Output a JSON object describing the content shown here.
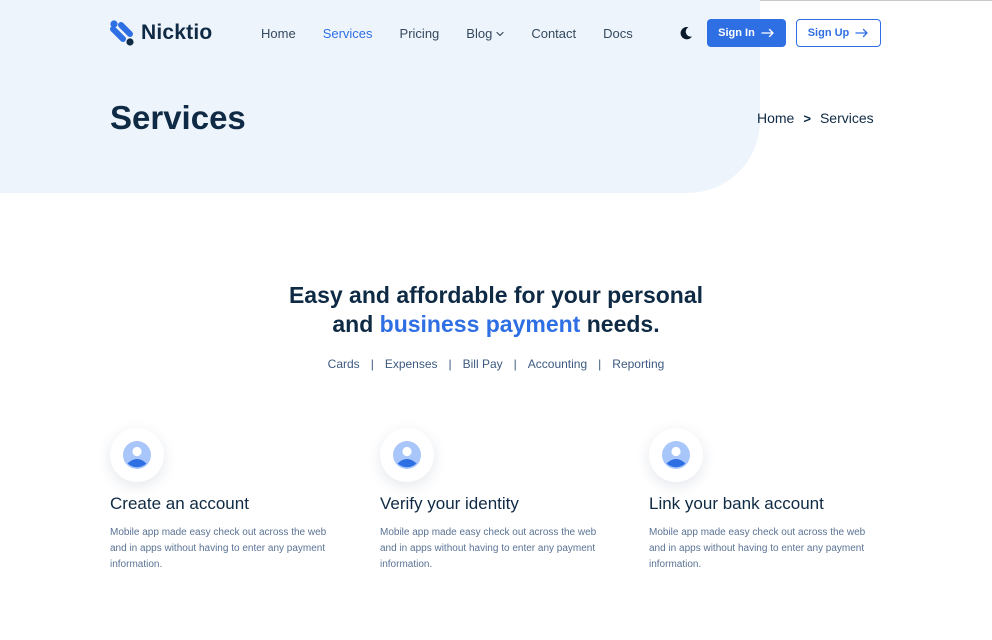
{
  "brand": {
    "name": "Nicktio",
    "accent": "#2f6fe4",
    "dark": "#0f2a44",
    "hero_bg": "#eef4fb"
  },
  "nav": {
    "items": [
      {
        "label": "Home"
      },
      {
        "label": "Services",
        "active": true
      },
      {
        "label": "Pricing"
      },
      {
        "label": "Blog",
        "dropdown": true
      },
      {
        "label": "Contact"
      },
      {
        "label": "Docs"
      }
    ],
    "theme_icon": "moon-icon",
    "signin_label": "Sign In",
    "signup_label": "Sign Up"
  },
  "hero": {
    "title": "Services",
    "breadcrumb": {
      "home": "Home",
      "separator": ">",
      "current": "Services"
    }
  },
  "section": {
    "headline_part1": "Easy and affordable for your personal",
    "headline_part2": "and",
    "headline_accent": "business payment",
    "headline_part3": "needs.",
    "categories": [
      "Cards",
      "Expenses",
      "Bill Pay",
      "Accounting",
      "Reporting"
    ],
    "category_separator": "|"
  },
  "features": [
    {
      "icon": "user-icon",
      "title": "Create an account",
      "desc": "Mobile app made easy check out across the web and in apps without having to enter any payment information."
    },
    {
      "icon": "user-icon",
      "title": "Verify your identity",
      "desc": "Mobile app made easy check out across the web and in apps without having to enter any payment information."
    },
    {
      "icon": "user-icon",
      "title": "Link your bank account",
      "desc": "Mobile app made easy check out across the web and in apps without having to enter any payment information."
    }
  ]
}
